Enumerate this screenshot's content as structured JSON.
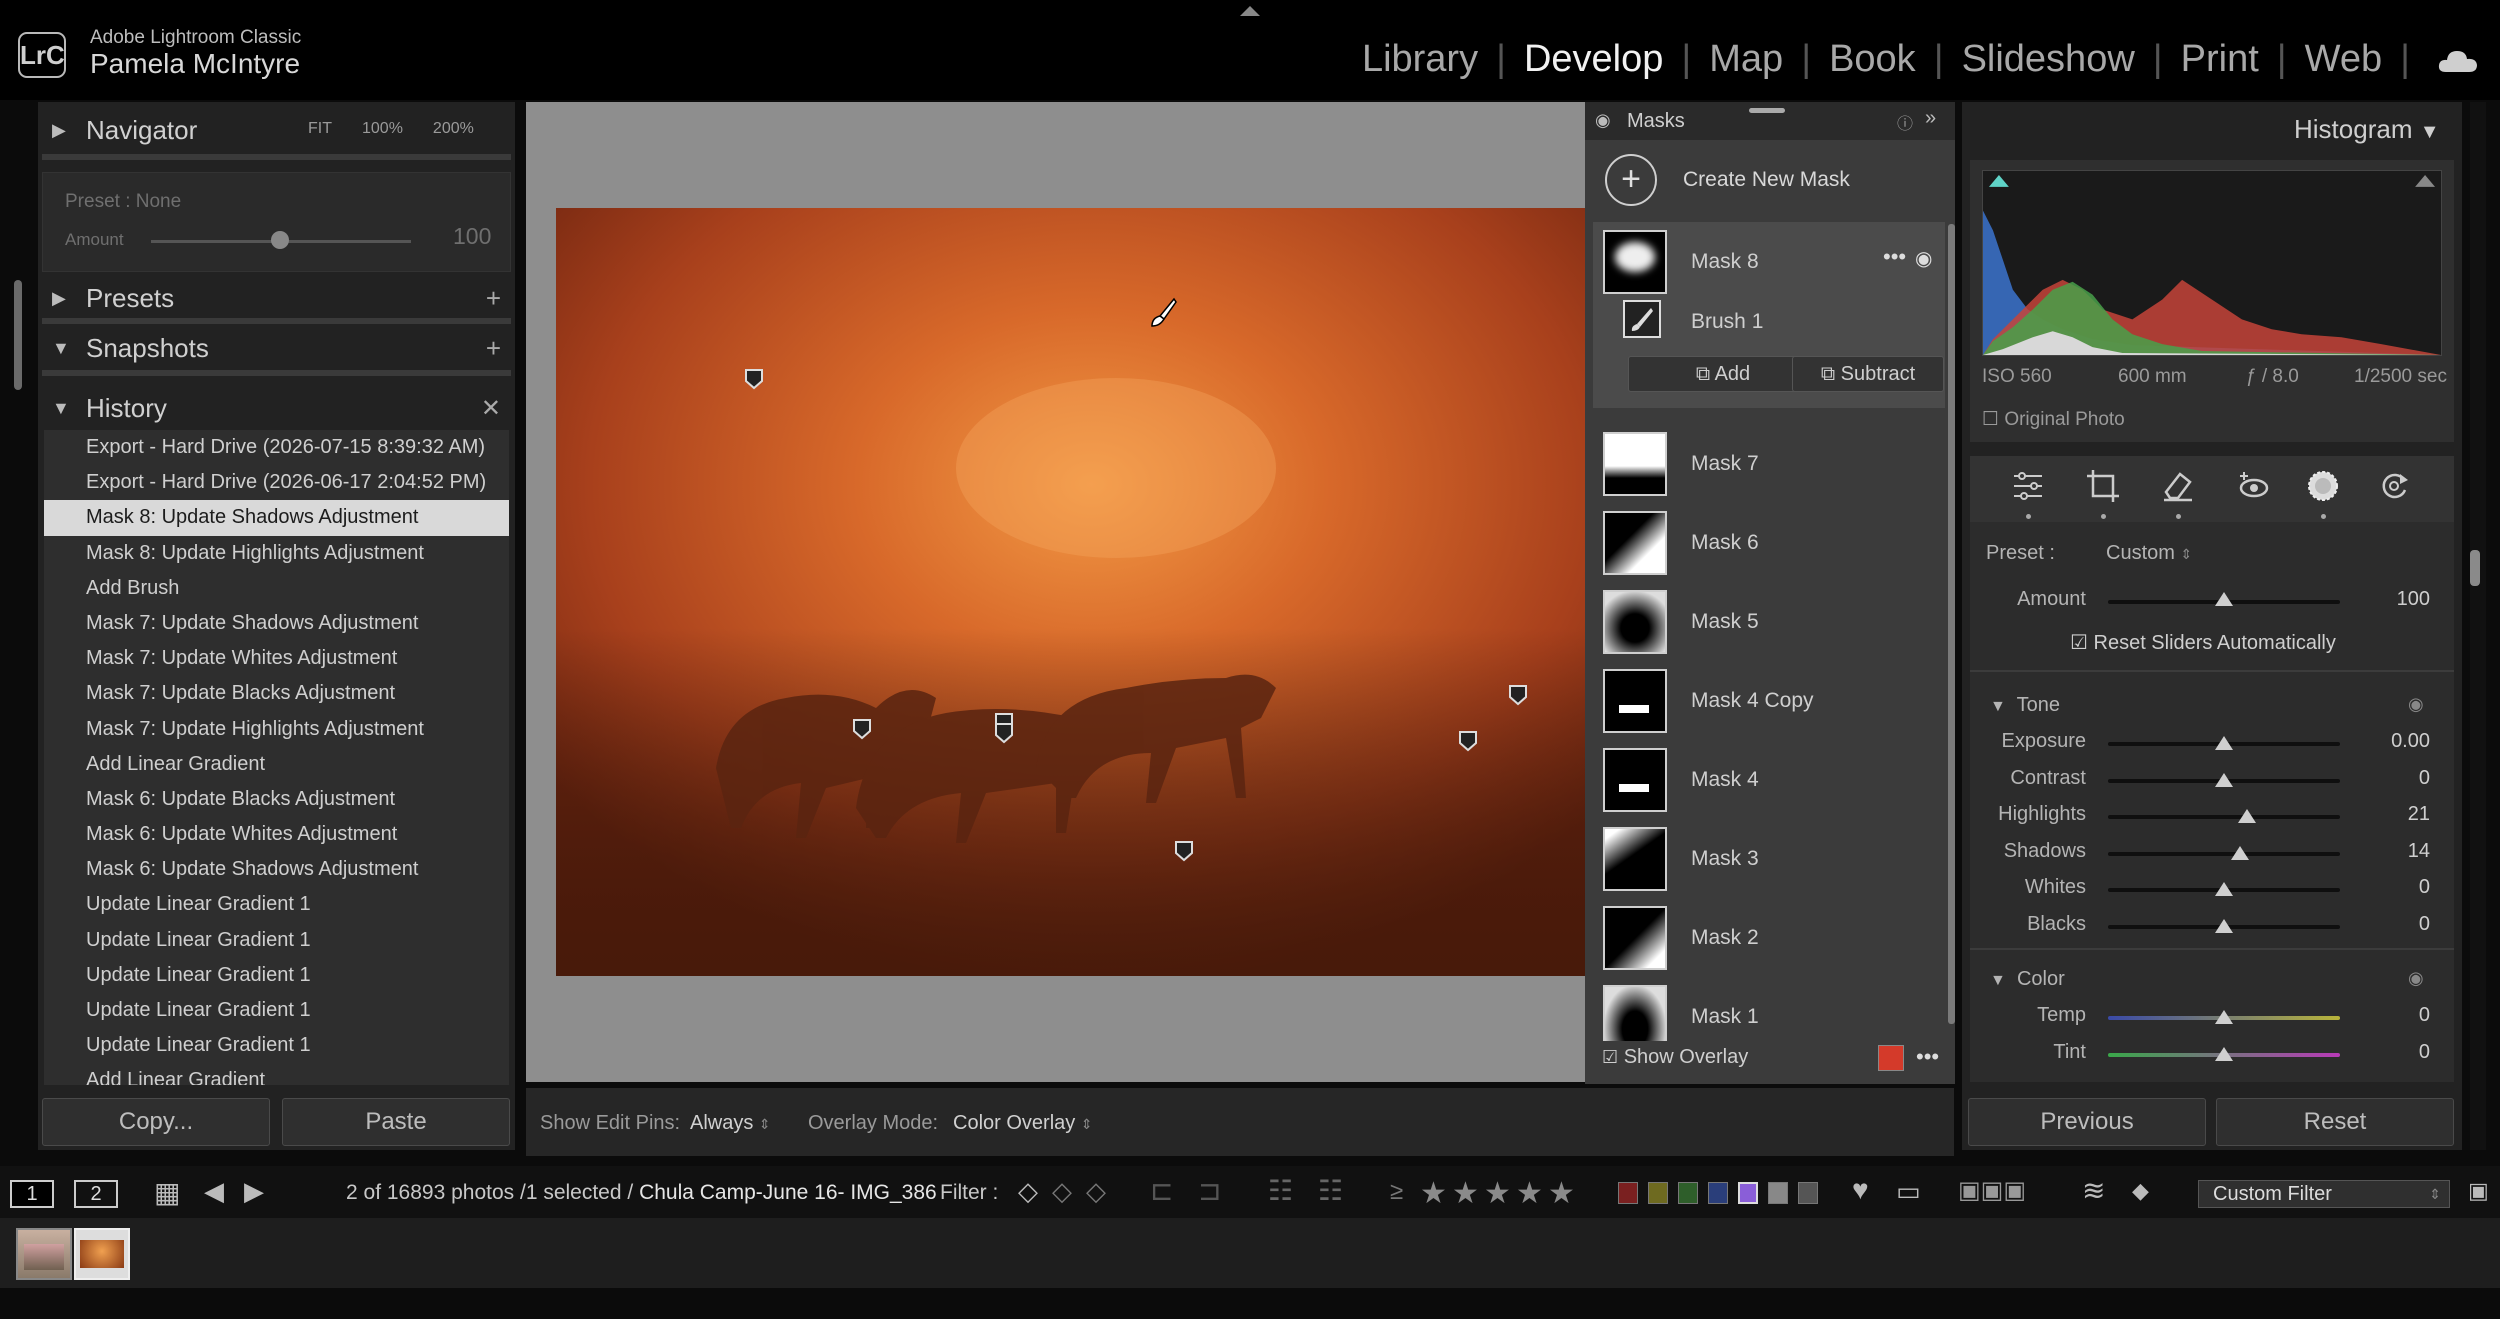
{
  "app": {
    "logo": "LrC",
    "name": "Adobe Lightroom Classic",
    "user": "Pamela McIntyre",
    "modules": [
      "Library",
      "Develop",
      "Map",
      "Book",
      "Slideshow",
      "Print",
      "Web"
    ],
    "active_module": "Develop"
  },
  "navigator": {
    "title": "Navigator",
    "zoom": [
      "FIT",
      "100%",
      "200%"
    ],
    "preset_label": "Preset : None",
    "amount_label": "Amount",
    "amount_value": "100"
  },
  "presets": {
    "title": "Presets"
  },
  "snapshots": {
    "title": "Snapshots"
  },
  "history": {
    "title": "History",
    "items": [
      "Export - Hard Drive (2026-07-15 8:39:32 AM)",
      "Export - Hard Drive (2026-06-17 2:04:52 PM)",
      "Mask 8: Update Shadows Adjustment",
      "Mask 8: Update Highlights Adjustment",
      "Add Brush",
      "Mask 7: Update Shadows Adjustment",
      "Mask 7: Update Whites Adjustment",
      "Mask 7: Update Blacks Adjustment",
      "Mask 7: Update Highlights Adjustment",
      "Add Linear Gradient",
      "Mask 6: Update Blacks Adjustment",
      "Mask 6: Update Whites Adjustment",
      "Mask 6: Update Shadows Adjustment",
      "Update Linear Gradient 1",
      "Update Linear Gradient 1",
      "Update Linear Gradient 1",
      "Update Linear Gradient 1",
      "Update Linear Gradient 1",
      "Add Linear Gradient"
    ],
    "selected_index": 2
  },
  "left_buttons": {
    "copy": "Copy...",
    "paste": "Paste"
  },
  "toolbar": {
    "pins_label": "Show Edit Pins:",
    "pins_value": "Always",
    "overlay_label": "Overlay Mode:",
    "overlay_value": "Color Overlay"
  },
  "masks": {
    "title": "Masks",
    "create_label": "Create New Mask",
    "active": {
      "name": "Mask 8",
      "component": "Brush 1",
      "add": "Add",
      "subtract": "Subtract"
    },
    "others": [
      "Mask 7",
      "Mask 6",
      "Mask 5",
      "Mask 4 Copy",
      "Mask 4",
      "Mask 3",
      "Mask 2",
      "Mask 1"
    ],
    "show_overlay": "Show Overlay",
    "overlay_color": "#d43a2a"
  },
  "histogram": {
    "title": "Histogram",
    "iso": "ISO 560",
    "focal": "600 mm",
    "aperture": "ƒ / 8.0",
    "shutter": "1/2500 sec",
    "original_photo": "Original Photo"
  },
  "tools": [
    "sliders-icon",
    "crop-icon",
    "eraser-icon",
    "redeye-icon",
    "masking-icon",
    "reset-icon"
  ],
  "mask_panel": {
    "preset_label": "Preset :",
    "preset_value": "Custom",
    "amount_label": "Amount",
    "amount_value": "100",
    "amount_fraction": 0.5,
    "reset_sliders": "Reset Sliders Automatically",
    "tone_title": "Tone",
    "tone": [
      {
        "label": "Exposure",
        "value": "0.00",
        "position": 0.5
      },
      {
        "label": "Contrast",
        "value": "0",
        "position": 0.5
      },
      {
        "label": "Highlights",
        "value": "21",
        "position": 0.6
      },
      {
        "label": "Shadows",
        "value": "14",
        "position": 0.57
      },
      {
        "label": "Whites",
        "value": "0",
        "position": 0.5
      },
      {
        "label": "Blacks",
        "value": "0",
        "position": 0.5
      }
    ],
    "color_title": "Color",
    "color": [
      {
        "label": "Temp",
        "value": "0",
        "position": 0.5
      },
      {
        "label": "Tint",
        "value": "0",
        "position": 0.5
      }
    ]
  },
  "right_buttons": {
    "previous": "Previous",
    "reset": "Reset"
  },
  "filmstrip": {
    "view1": "1",
    "view2": "2",
    "count": "2 of 16893 photos /1 selected /",
    "filename": "Chula Camp-June 16- IMG_386",
    "filter_label": "Filter :",
    "rating_op": "≥",
    "custom_filter": "Custom Filter"
  }
}
